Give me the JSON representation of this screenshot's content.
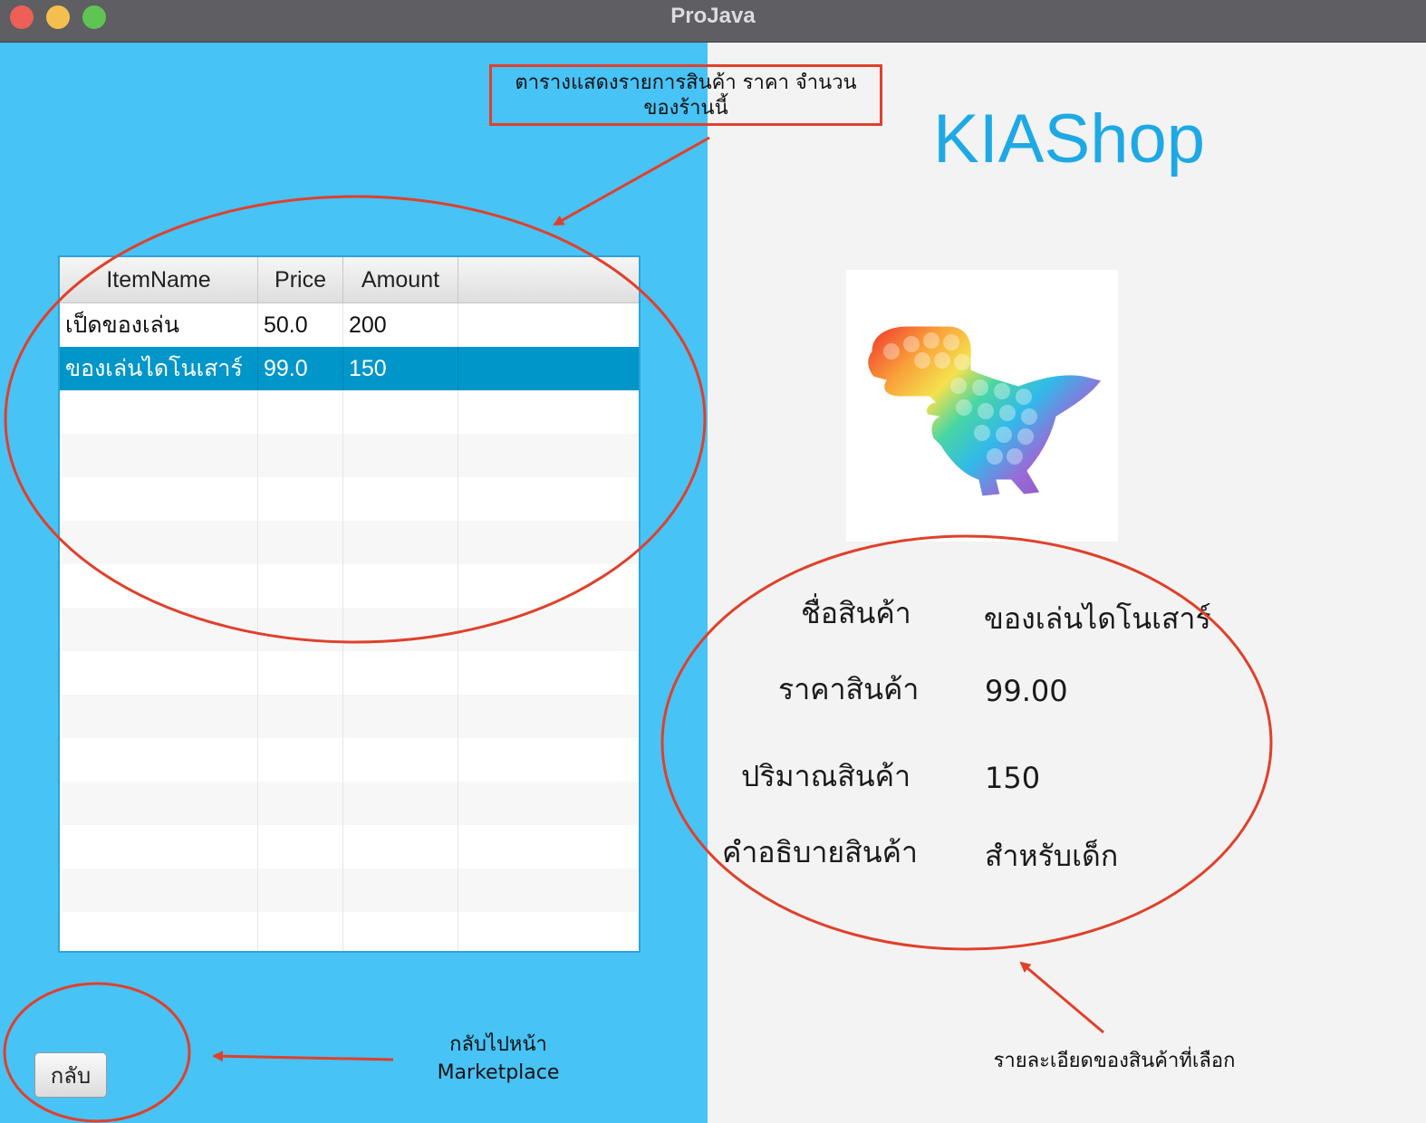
{
  "window": {
    "title": "ProJava"
  },
  "table": {
    "columns": [
      "ItemName",
      "Price",
      "Amount",
      ""
    ],
    "rows": [
      [
        "เป็ดของเล่น",
        "50.0",
        "200"
      ],
      [
        "ของเล่นไดโนเสาร์",
        "99.0",
        "150"
      ]
    ],
    "selected_row": 1
  },
  "back_button": {
    "label": "กลับ"
  },
  "shop": {
    "title": "KIAShop"
  },
  "product_image": {
    "icon": "rainbow-dinosaur-pop-it-toy"
  },
  "details": {
    "name_label": "ชื่อสินค้า",
    "name_value": "ของเล่นไดโนเสาร์",
    "price_label": "ราคาสินค้า",
    "price_value": "99.00",
    "amount_label": "ปริมาณสินค้า",
    "amount_value": "150",
    "desc_label": "คำอธิบายสินค้า",
    "desc_value": "สำหรับเด็ก"
  },
  "annotations": {
    "table_note_line1": "ตารางแสดงรายการสินค้า ราคา จำนวน",
    "table_note_line2": "ของร้านนี้",
    "back_note_line1": "กลับไปหน้า",
    "back_note_line2": "Marketplace",
    "detail_note": "รายละเอียดของสินค้าที่เลือก"
  },
  "colors": {
    "left_background": "#47c3f6",
    "selected_row": "#0096c9",
    "annotation_red": "#e0402b",
    "title_blue": "#1ea9e6"
  }
}
